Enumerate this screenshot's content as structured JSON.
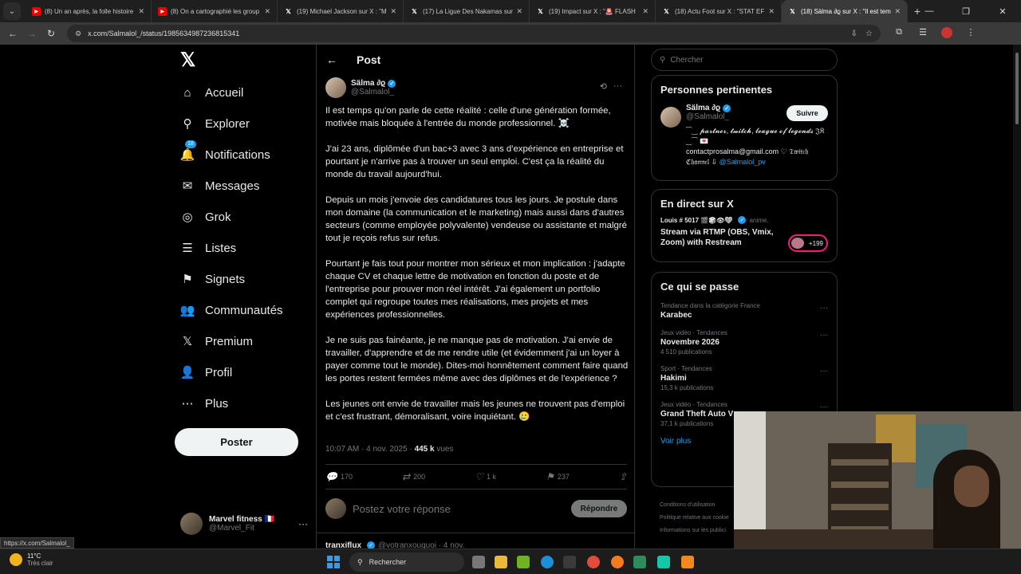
{
  "browser": {
    "tabs": [
      {
        "icon": "youtube-icon",
        "title": "(8) Un an après, la folle histoire",
        "active": false
      },
      {
        "icon": "youtube-icon",
        "title": "(8) On a cartographié les group",
        "active": false
      },
      {
        "icon": "x-icon",
        "title": "(19) Michael Jackson sur X : \"M",
        "active": false
      },
      {
        "icon": "x-icon",
        "title": "(17) La Ligue Des Nakamas sur",
        "active": false
      },
      {
        "icon": "x-icon",
        "title": "(19) Impact sur X : \"🚨 FLASH",
        "active": false
      },
      {
        "icon": "x-icon",
        "title": "(18) Actu Foot sur X : \"STAT EF",
        "active": false
      },
      {
        "icon": "x-icon",
        "title": "(18) Sälma ∂ϱ sur X : \"Il est tem",
        "active": true
      }
    ],
    "url": "x.com/Salmalol_/status/1985634987236815341"
  },
  "nav": {
    "items": [
      {
        "icon": "home-icon",
        "glyph": "⌂",
        "label": "Accueil"
      },
      {
        "icon": "search-icon",
        "glyph": "⚲",
        "label": "Explorer"
      },
      {
        "icon": "bell-icon",
        "glyph": "🔔",
        "label": "Notifications",
        "badge": "18"
      },
      {
        "icon": "mail-icon",
        "glyph": "✉",
        "label": "Messages"
      },
      {
        "icon": "grok-icon",
        "glyph": "◎",
        "label": "Grok"
      },
      {
        "icon": "list-icon",
        "glyph": "☰",
        "label": "Listes"
      },
      {
        "icon": "bookmark-icon",
        "glyph": "⚑",
        "label": "Signets"
      },
      {
        "icon": "communities-icon",
        "glyph": "👥",
        "label": "Communautés"
      },
      {
        "icon": "x-premium-icon",
        "glyph": "𝕏",
        "label": "Premium"
      },
      {
        "icon": "profile-icon",
        "glyph": "👤",
        "label": "Profil"
      },
      {
        "icon": "more-circle-icon",
        "glyph": "⋯",
        "label": "Plus"
      }
    ],
    "post_button": "Poster",
    "account": {
      "name": "Marvel fitness 🇫🇷",
      "handle": "@Marvel_Fit"
    }
  },
  "post": {
    "header": "Post",
    "author": {
      "name": "Sälma ∂ϱ",
      "handle": "@Salmalol_"
    },
    "paragraphs": [
      "Il est temps qu'on parle de cette réalité : celle d'une génération formée, motivée mais bloquée à l'entrée du monde professionnel. ☠️",
      "J'ai 23 ans, diplômée d'un bac+3 avec 3 ans d'expérience en entreprise et pourtant je n'arrive pas à trouver un seul emploi. C'est ça  la réalité du monde du travail aujourd'hui.",
      "Depuis un mois j'envoie des candidatures tous les jours. Je postule dans mon domaine (la communication et le marketing) mais aussi dans d'autres secteurs (comme employée polyvalente)  vendeuse ou assistante et malgré tout je reçois refus sur refus.",
      "Pourtant je fais tout pour montrer mon sérieux et mon implication : j'adapte chaque CV et chaque lettre de motivation en fonction du poste et de l'entreprise pour prouver mon réel intérêt. J'ai également un portfolio complet qui regroupe toutes mes réalisations, mes projets et mes expériences professionnelles.",
      "Je ne suis pas fainéante, je ne manque pas de motivation. J'ai envie de travailler, d'apprendre et de me rendre utile (et évidemment j'ai un loyer à payer comme tout le monde). Dites-moi honnêtement comment faire quand les portes restent fermées même avec des diplômes et de l'expérience ?",
      "Les jeunes ont envie de travailler mais les jeunes ne trouvent pas d'emploi et c'est frustrant, démoralisant, voire inquiétant. 🥲"
    ],
    "timestamp": "10:07 AM · 4 nov. 2025 ·",
    "views": "445 k",
    "views_label": "vues",
    "stats": {
      "replies": "170",
      "reposts": "200",
      "likes": "1 k",
      "bookmarks": "237"
    },
    "reply_placeholder": "Postez votre réponse",
    "reply_button": "Répondre",
    "next": {
      "name": "tranxiflux",
      "handle": "@votranxouquoi · 4 nov."
    }
  },
  "sidebar": {
    "search_placeholder": "Chercher",
    "relevant": {
      "title": "Personnes pertinentes",
      "name": "Sälma ∂ϱ",
      "handle": "@Salmalol_",
      "follow": "Suivre",
      "bio1": "⁀‿ 𝓹𝓪𝓻𝓽𝓷𝓮𝓻, 𝓽𝔀𝓲𝓽𝓬𝓱, 𝓵𝓮𝓪𝓰𝓾𝓮 𝓸𝓯 𝓵𝓮𝓰𝓮𝓷𝓭𝓼 𝔍𝔎 ‿⁀ 💌",
      "bio2": "contactprosalma@gmail.com ♡ 𝔗𝔴𝔦𝔱𝔠𝔥 ℭ𝔥𝔞𝔫𝔫𝔢𝔩 ⇩",
      "bio_link": "@Salmalol_pv"
    },
    "live": {
      "title": "En direct sur X",
      "host": "Louis # 5017 🎬🎲👁❤",
      "status": "anime.",
      "stream": "Stream via RTMP (OBS, Vmix, Zoom) with Restream",
      "count": "+199"
    },
    "trends": {
      "title": "Ce qui se passe",
      "items": [
        {
          "category": "Tendance dans la catégorie France",
          "name": "Karabec",
          "count": ""
        },
        {
          "category": "Jeux vidéo · Tendances",
          "name": "Novembre 2026",
          "count": "4 510 publications"
        },
        {
          "category": "Sport · Tendances",
          "name": "Hakimi",
          "count": "15,3 k publications"
        },
        {
          "category": "Jeux vidéo · Tendances",
          "name": "Grand Theft Auto V",
          "count": "37,1 k publications"
        }
      ],
      "see_more": "Voir plus"
    },
    "footer": [
      "Conditions d'utilisation",
      "Politique relative aux cookie",
      "Informations sur les publici"
    ]
  },
  "status_bar": {
    "hover_url": "https://x.com/Salmalol_"
  },
  "taskbar": {
    "temp": "11°C",
    "weather": "Très clair",
    "search": "Rechercher"
  }
}
